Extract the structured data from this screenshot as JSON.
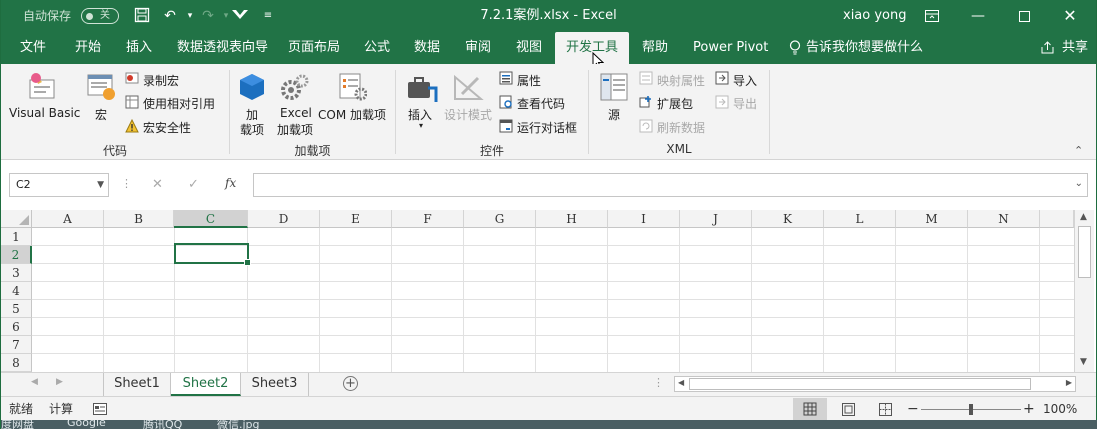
{
  "titlebar": {
    "autosave_label": "自动保存",
    "autosave_state": "关",
    "title": "7.2.1案例.xlsx  -  Excel",
    "user": "xiao yong"
  },
  "tabs": [
    "文件",
    "开始",
    "插入",
    "数据透视表向导",
    "页面布局",
    "公式",
    "数据",
    "审阅",
    "视图",
    "开发工具",
    "帮助",
    "Power Pivot",
    "告诉我你想要做什么",
    "共享"
  ],
  "active_tab": "开发工具",
  "ribbon": {
    "code": {
      "visual_basic": "Visual Basic",
      "macro": "宏",
      "record_macro": "录制宏",
      "relative_ref": "使用相对引用",
      "macro_security": "宏安全性",
      "group": "代码"
    },
    "addins": {
      "addin_top": "加",
      "addin_bottom": "载项",
      "excel_top": "Excel",
      "excel_bottom": "加载项",
      "com": "COM 加载项",
      "group": "加载项"
    },
    "controls": {
      "insert": "插入",
      "design_mode": "设计模式",
      "properties": "属性",
      "view_code": "查看代码",
      "run_dialog": "运行对话框",
      "group": "控件"
    },
    "xml": {
      "source": "源",
      "map_props": "映射属性",
      "expansion": "扩展包",
      "refresh": "刷新数据",
      "import": "导入",
      "export": "导出",
      "group": "XML"
    }
  },
  "formula_bar": {
    "name_box": "C2",
    "cancel": "✕",
    "enter": "✓",
    "fx": "fx",
    "formula": ""
  },
  "columns": [
    "A",
    "B",
    "C",
    "D",
    "E",
    "F",
    "G",
    "H",
    "I",
    "J",
    "K",
    "L",
    "M",
    "N"
  ],
  "rows": [
    "1",
    "2",
    "3",
    "4",
    "5",
    "6",
    "7",
    "8"
  ],
  "selected_cell": "C2",
  "sheets": [
    "Sheet1",
    "Sheet2",
    "Sheet3"
  ],
  "active_sheet": "Sheet2",
  "status": {
    "ready": "就绪",
    "calc": "计算",
    "zoom": "100%"
  },
  "taskbar": [
    "度网盘",
    "Google",
    "腾讯QQ",
    "微信.jpg"
  ],
  "colors": {
    "accent": "#217346",
    "ribbon_bg": "#f3f3f3"
  }
}
